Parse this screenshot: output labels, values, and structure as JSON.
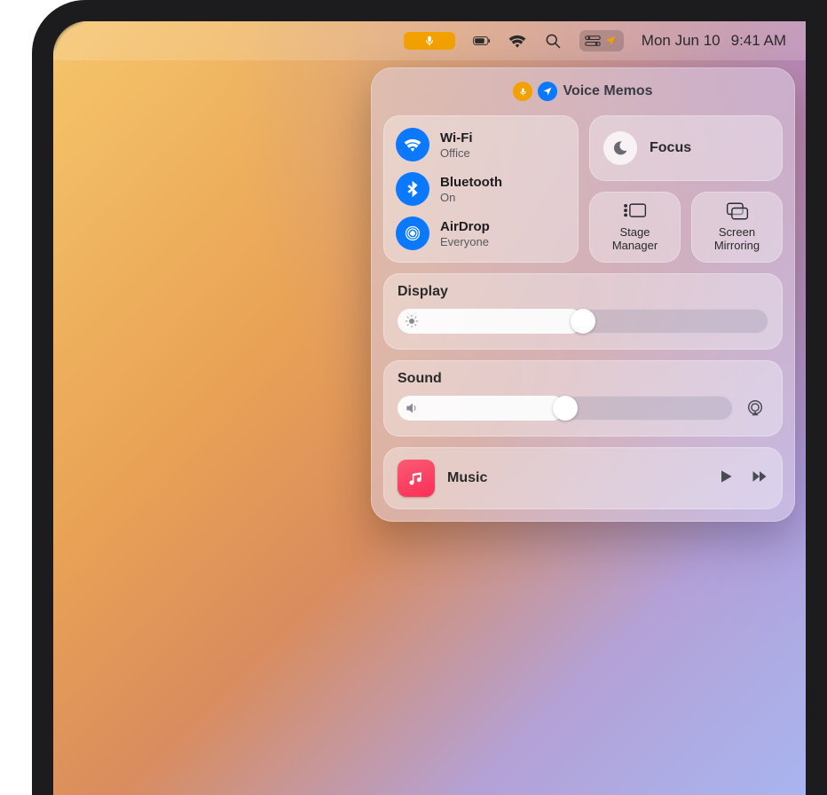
{
  "menubar": {
    "date": "Mon Jun 10",
    "time": "9:41 AM"
  },
  "header": {
    "app": "Voice Memos"
  },
  "connectivity": {
    "wifi": {
      "label": "Wi-Fi",
      "status": "Office"
    },
    "bluetooth": {
      "label": "Bluetooth",
      "status": "On"
    },
    "airdrop": {
      "label": "AirDrop",
      "status": "Everyone"
    }
  },
  "focus": {
    "label": "Focus"
  },
  "stage_manager": {
    "label": "Stage\nManager"
  },
  "screen_mirroring": {
    "label": "Screen\nMirroring"
  },
  "display": {
    "label": "Display",
    "value": 50
  },
  "sound": {
    "label": "Sound",
    "value": 50
  },
  "now_playing": {
    "label": "Music"
  }
}
